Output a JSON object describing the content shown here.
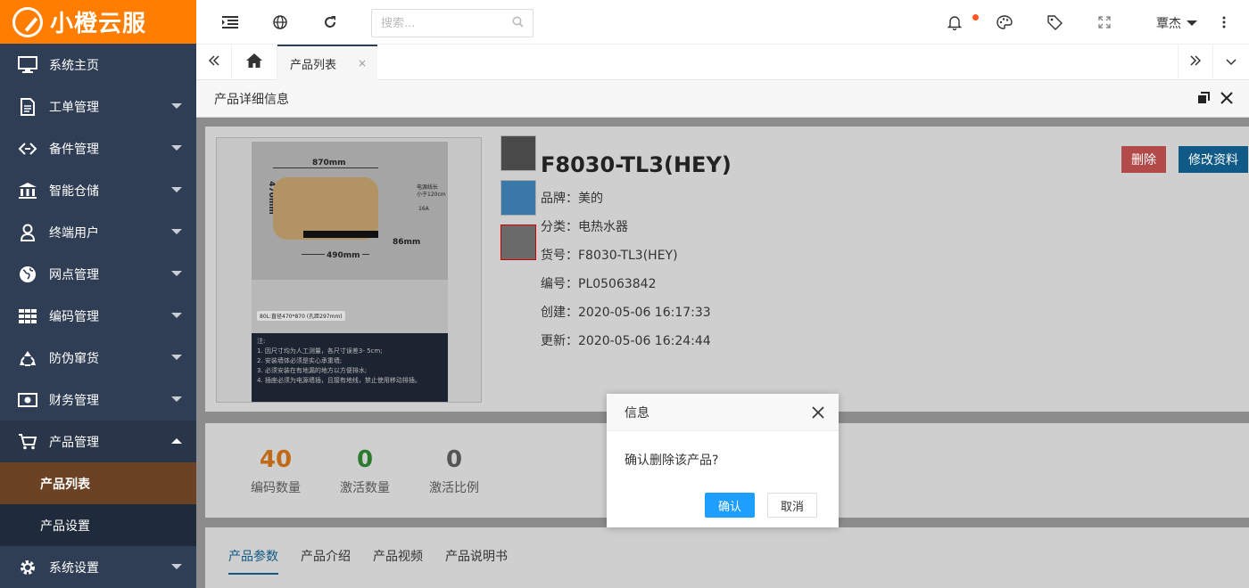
{
  "app": {
    "name": "小橙云服"
  },
  "sidebar": {
    "items": [
      {
        "label": "系统主页",
        "icon": "monitor-icon"
      },
      {
        "label": "工单管理",
        "icon": "document-icon"
      },
      {
        "label": "备件管理",
        "icon": "link-icon"
      },
      {
        "label": "智能仓储",
        "icon": "bank-icon"
      },
      {
        "label": "终端用户",
        "icon": "user-icon"
      },
      {
        "label": "网点管理",
        "icon": "globe-icon"
      },
      {
        "label": "编码管理",
        "icon": "grid-icon"
      },
      {
        "label": "防伪窜货",
        "icon": "recycle-icon"
      },
      {
        "label": "财务管理",
        "icon": "money-icon"
      },
      {
        "label": "产品管理",
        "icon": "cart-icon"
      },
      {
        "label": "系统设置",
        "icon": "gear-icon"
      }
    ],
    "sub_items": [
      {
        "label": "产品列表"
      },
      {
        "label": "产品设置"
      }
    ]
  },
  "header": {
    "search_placeholder": "搜索...",
    "user_name": "覃杰"
  },
  "tabs": {
    "open_tab": "产品列表",
    "close_glyph": "×"
  },
  "page": {
    "title": "产品详细信息"
  },
  "product": {
    "name": "F8030-TL3(HEY)",
    "brand": "品牌：美的",
    "category": "分类：电热水器",
    "sku": "货号：F8030-TL3(HEY)",
    "code": "编号：PL05063842",
    "created": "创建：2020-05-06 16:17:33",
    "updated": "更新：2020-05-06 16:24:44",
    "image": {
      "width_label": "870mm",
      "height_label": "470mm",
      "bottom_label": "490mm",
      "side_label": "86mm",
      "power_note": "电源线长\n小于120cm",
      "amp": "16A",
      "caption": "80L:直径470*870 (孔距297mm)",
      "notes": "注:\n1. 因尺寸均为人工测量，各尺寸误差3- 5cm;\n2. 安装墙体必须是实心承重墙;\n3. 必须安装在有地漏的地方以方便排水;\n4. 插座必须为电源墙插，且接有地线，禁止使用移动排插。"
    }
  },
  "actions": {
    "delete": "删除",
    "edit": "修改资料"
  },
  "stats": [
    {
      "value": "40",
      "label": "编码数量",
      "color": "#c06a17"
    },
    {
      "value": "0",
      "label": "激活数量",
      "color": "#2c7a2c"
    },
    {
      "value": "0",
      "label": "激活比例",
      "color": "#555555"
    }
  ],
  "product_tabs": [
    "产品参数",
    "产品介绍",
    "产品视频",
    "产品说明书"
  ],
  "dialog": {
    "title": "信息",
    "message": "确认删除该产品?",
    "ok": "确认",
    "cancel": "取消"
  },
  "colors": {
    "brand": "#ff7d00",
    "sidebar": "#2f3e55",
    "active_sub": "#6b4324",
    "primary": "#1e9fff",
    "danger": "#b24a4a"
  }
}
